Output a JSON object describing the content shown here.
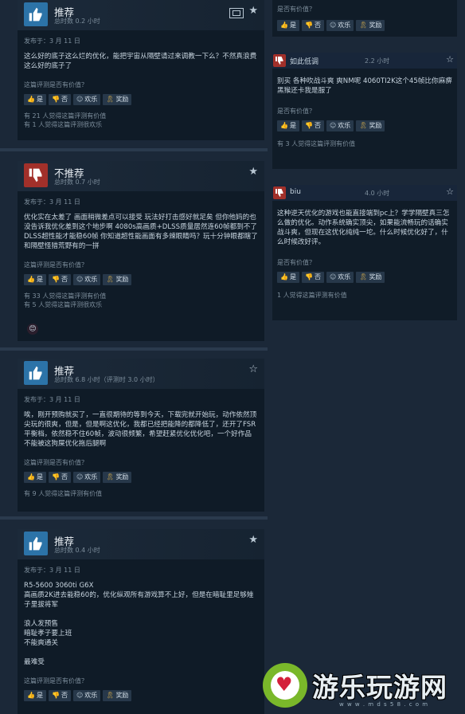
{
  "labels": {
    "helpful_question": "这篇评测是否有价值？",
    "helpful_question_short": "是否有价值？",
    "posted_prefix": "发布于：",
    "yes": "是",
    "no": "否",
    "funny": "欢乐",
    "award": "奖励"
  },
  "left_reviews": [
    {
      "verdict": "推荐",
      "hours": "总时数 0.2 小时",
      "date": "发布于：3 月 11 日",
      "text": "这么好的底子这么烂的优化，能把宇宙从隔壁请过来调教一下么？不然真浪费这么好的底子了",
      "stats": [
        "有 21 人觉得这篇评测有价值",
        "有 1 人觉得这篇评测很欢乐"
      ]
    },
    {
      "verdict": "不推荐",
      "hours": "总时数 0.7 小时",
      "date": "发布于：3 月 11 日",
      "text": "优化实在太差了 画面稍微差点可以接受 玩法好打击感好就足矣 但你他妈的也没告诉我优化差到这个地步啊 4080s高画质+DLSS质量居然连60帧都到不了 DLSS超性能才能稳60帧 你知道超性能画面有多辣眼睛吗？玩十分钟眼都瞎了 和隔壁怪猎荒野有的一拼",
      "stats": [
        "有 33 人觉得这篇评测有价值",
        "有 5 人觉得这篇评测很欢乐"
      ]
    },
    {
      "verdict": "推荐",
      "hours": "总时数 6.8 小时（评测时 3.0 小时）",
      "date": "发布于：3 月 11 日",
      "text": "唉，刚开预购就买了，一直很期待的等到今天，下载完就开始玩，动作依然顶尖玩的很爽，但是，但是啊这优化，我都已经把能降的都降低了，还开了FSR平衡档，依然稳不住60帧，波动很频繁，希望赶紧优化优化吧，一个好作品不能被这狗屎优化拖后腿啊",
      "stats": [
        "有 9 人觉得这篇评测有价值"
      ]
    },
    {
      "verdict": "推荐",
      "hours": "总时数 0.4 小时",
      "date": "发布于：3 月 11 日",
      "text": "R5-5600 3060ti G6X\n高画质2K进去能稳60的，优化纵观所有游戏算不上好，但是在暗耻里足够矬子里拔将军\n\n浪人发预售\n暗耻孝子要上班\n不能爽通关\n\n最难受",
      "stats": []
    }
  ],
  "right_reviews": [
    {
      "user": "如此低调",
      "hours": "2.2 小时",
      "text": "别买 各种吹战斗爽 爽NM呢 4060TI2K这个45帧比你麻痹黑猴还卡我是服了",
      "stats": [
        "有 3 人觉得这篇评测有价值"
      ]
    },
    {
      "user": "biu",
      "hours": "4.0 小时",
      "text": "这种逆天优化的游戏也能直接端到pc上？学学隔壁真三怎么做的优化。动作系统确实顶尖，如果能流畅玩的话确实战斗爽，但现在这优化纯纯一坨。什么时候优化好了，什么时候改好评。",
      "stats": [
        "1 人觉得这篇评测有价值"
      ]
    }
  ],
  "watermark": {
    "text": "游乐玩游网",
    "sub": "w w w . m d s 5 8 . c o m"
  },
  "colors": {
    "page_bg": "#1b2838",
    "recommend": "#2c73a8",
    "not_recommend": "#a2302a",
    "award": "#e0b34c"
  },
  "icons": [
    "thumbs-up-icon",
    "thumbs-down-icon",
    "star-icon",
    "film-icon",
    "smiley-icon",
    "award-ribbon-icon"
  ]
}
